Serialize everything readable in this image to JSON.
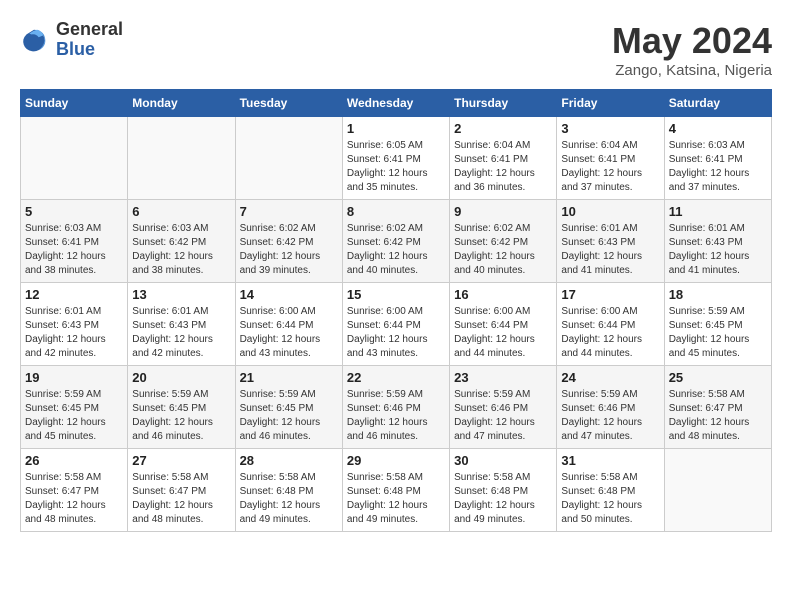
{
  "logo": {
    "general": "General",
    "blue": "Blue"
  },
  "title": "May 2024",
  "subtitle": "Zango, Katsina, Nigeria",
  "weekdays": [
    "Sunday",
    "Monday",
    "Tuesday",
    "Wednesday",
    "Thursday",
    "Friday",
    "Saturday"
  ],
  "weeks": [
    [
      {
        "day": "",
        "info": ""
      },
      {
        "day": "",
        "info": ""
      },
      {
        "day": "",
        "info": ""
      },
      {
        "day": "1",
        "info": "Sunrise: 6:05 AM\nSunset: 6:41 PM\nDaylight: 12 hours\nand 35 minutes."
      },
      {
        "day": "2",
        "info": "Sunrise: 6:04 AM\nSunset: 6:41 PM\nDaylight: 12 hours\nand 36 minutes."
      },
      {
        "day": "3",
        "info": "Sunrise: 6:04 AM\nSunset: 6:41 PM\nDaylight: 12 hours\nand 37 minutes."
      },
      {
        "day": "4",
        "info": "Sunrise: 6:03 AM\nSunset: 6:41 PM\nDaylight: 12 hours\nand 37 minutes."
      }
    ],
    [
      {
        "day": "5",
        "info": "Sunrise: 6:03 AM\nSunset: 6:41 PM\nDaylight: 12 hours\nand 38 minutes."
      },
      {
        "day": "6",
        "info": "Sunrise: 6:03 AM\nSunset: 6:42 PM\nDaylight: 12 hours\nand 38 minutes."
      },
      {
        "day": "7",
        "info": "Sunrise: 6:02 AM\nSunset: 6:42 PM\nDaylight: 12 hours\nand 39 minutes."
      },
      {
        "day": "8",
        "info": "Sunrise: 6:02 AM\nSunset: 6:42 PM\nDaylight: 12 hours\nand 40 minutes."
      },
      {
        "day": "9",
        "info": "Sunrise: 6:02 AM\nSunset: 6:42 PM\nDaylight: 12 hours\nand 40 minutes."
      },
      {
        "day": "10",
        "info": "Sunrise: 6:01 AM\nSunset: 6:43 PM\nDaylight: 12 hours\nand 41 minutes."
      },
      {
        "day": "11",
        "info": "Sunrise: 6:01 AM\nSunset: 6:43 PM\nDaylight: 12 hours\nand 41 minutes."
      }
    ],
    [
      {
        "day": "12",
        "info": "Sunrise: 6:01 AM\nSunset: 6:43 PM\nDaylight: 12 hours\nand 42 minutes."
      },
      {
        "day": "13",
        "info": "Sunrise: 6:01 AM\nSunset: 6:43 PM\nDaylight: 12 hours\nand 42 minutes."
      },
      {
        "day": "14",
        "info": "Sunrise: 6:00 AM\nSunset: 6:44 PM\nDaylight: 12 hours\nand 43 minutes."
      },
      {
        "day": "15",
        "info": "Sunrise: 6:00 AM\nSunset: 6:44 PM\nDaylight: 12 hours\nand 43 minutes."
      },
      {
        "day": "16",
        "info": "Sunrise: 6:00 AM\nSunset: 6:44 PM\nDaylight: 12 hours\nand 44 minutes."
      },
      {
        "day": "17",
        "info": "Sunrise: 6:00 AM\nSunset: 6:44 PM\nDaylight: 12 hours\nand 44 minutes."
      },
      {
        "day": "18",
        "info": "Sunrise: 5:59 AM\nSunset: 6:45 PM\nDaylight: 12 hours\nand 45 minutes."
      }
    ],
    [
      {
        "day": "19",
        "info": "Sunrise: 5:59 AM\nSunset: 6:45 PM\nDaylight: 12 hours\nand 45 minutes."
      },
      {
        "day": "20",
        "info": "Sunrise: 5:59 AM\nSunset: 6:45 PM\nDaylight: 12 hours\nand 46 minutes."
      },
      {
        "day": "21",
        "info": "Sunrise: 5:59 AM\nSunset: 6:45 PM\nDaylight: 12 hours\nand 46 minutes."
      },
      {
        "day": "22",
        "info": "Sunrise: 5:59 AM\nSunset: 6:46 PM\nDaylight: 12 hours\nand 46 minutes."
      },
      {
        "day": "23",
        "info": "Sunrise: 5:59 AM\nSunset: 6:46 PM\nDaylight: 12 hours\nand 47 minutes."
      },
      {
        "day": "24",
        "info": "Sunrise: 5:59 AM\nSunset: 6:46 PM\nDaylight: 12 hours\nand 47 minutes."
      },
      {
        "day": "25",
        "info": "Sunrise: 5:58 AM\nSunset: 6:47 PM\nDaylight: 12 hours\nand 48 minutes."
      }
    ],
    [
      {
        "day": "26",
        "info": "Sunrise: 5:58 AM\nSunset: 6:47 PM\nDaylight: 12 hours\nand 48 minutes."
      },
      {
        "day": "27",
        "info": "Sunrise: 5:58 AM\nSunset: 6:47 PM\nDaylight: 12 hours\nand 48 minutes."
      },
      {
        "day": "28",
        "info": "Sunrise: 5:58 AM\nSunset: 6:48 PM\nDaylight: 12 hours\nand 49 minutes."
      },
      {
        "day": "29",
        "info": "Sunrise: 5:58 AM\nSunset: 6:48 PM\nDaylight: 12 hours\nand 49 minutes."
      },
      {
        "day": "30",
        "info": "Sunrise: 5:58 AM\nSunset: 6:48 PM\nDaylight: 12 hours\nand 49 minutes."
      },
      {
        "day": "31",
        "info": "Sunrise: 5:58 AM\nSunset: 6:48 PM\nDaylight: 12 hours\nand 50 minutes."
      },
      {
        "day": "",
        "info": ""
      }
    ]
  ]
}
